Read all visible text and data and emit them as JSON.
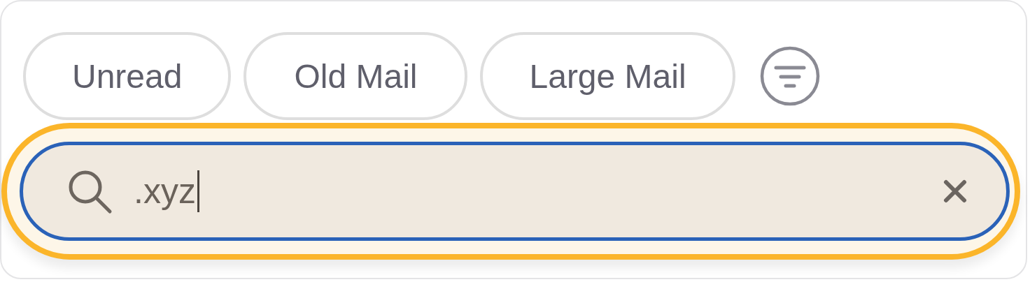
{
  "filters": [
    {
      "label": "Unread",
      "selected": false
    },
    {
      "label": "Old Mail",
      "selected": false
    },
    {
      "label": "Large Mail",
      "selected": false
    }
  ],
  "search": {
    "value": ".xyz",
    "focused": true
  }
}
